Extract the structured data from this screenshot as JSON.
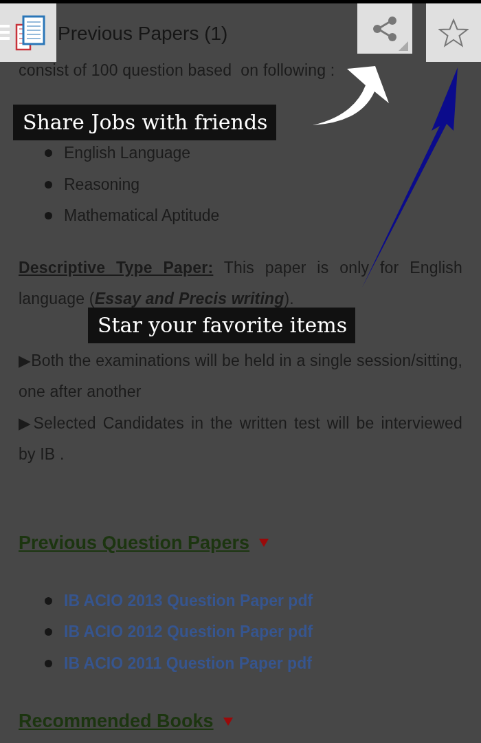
{
  "app_bar": {
    "title": "Previous Papers (1)"
  },
  "content": [
    {
      "kind": "paragraph",
      "text": "consist of 100 question based  on following :"
    },
    {
      "kind": "bullets",
      "items": [
        "English Language",
        "Reasoning",
        "Mathematical Aptitude"
      ]
    },
    {
      "kind": "paragraph",
      "text": "**Descriptive Type Paper:** This paper is only for English language (**Essay and Precis writing**)."
    },
    {
      "kind": "paragraph",
      "text": "▶Both the examinations will be held in a single session/sitting, one after another"
    },
    {
      "kind": "paragraph",
      "text": "▶Selected Candidates in the written test will be interviewed by IB ."
    },
    {
      "kind": "heading",
      "text": "Previous Question Papers"
    },
    {
      "kind": "links",
      "items": [
        "IB ACIO 2013 Question Paper pdf",
        "IB ACIO 2012 Question Paper pdf",
        "IB ACIO 2011 Question Paper pdf"
      ]
    },
    {
      "kind": "heading",
      "text": "Recommended Books"
    }
  ],
  "tips": [
    {
      "text": "Share Jobs with friends"
    },
    {
      "text": "Star your favorite items"
    }
  ]
}
